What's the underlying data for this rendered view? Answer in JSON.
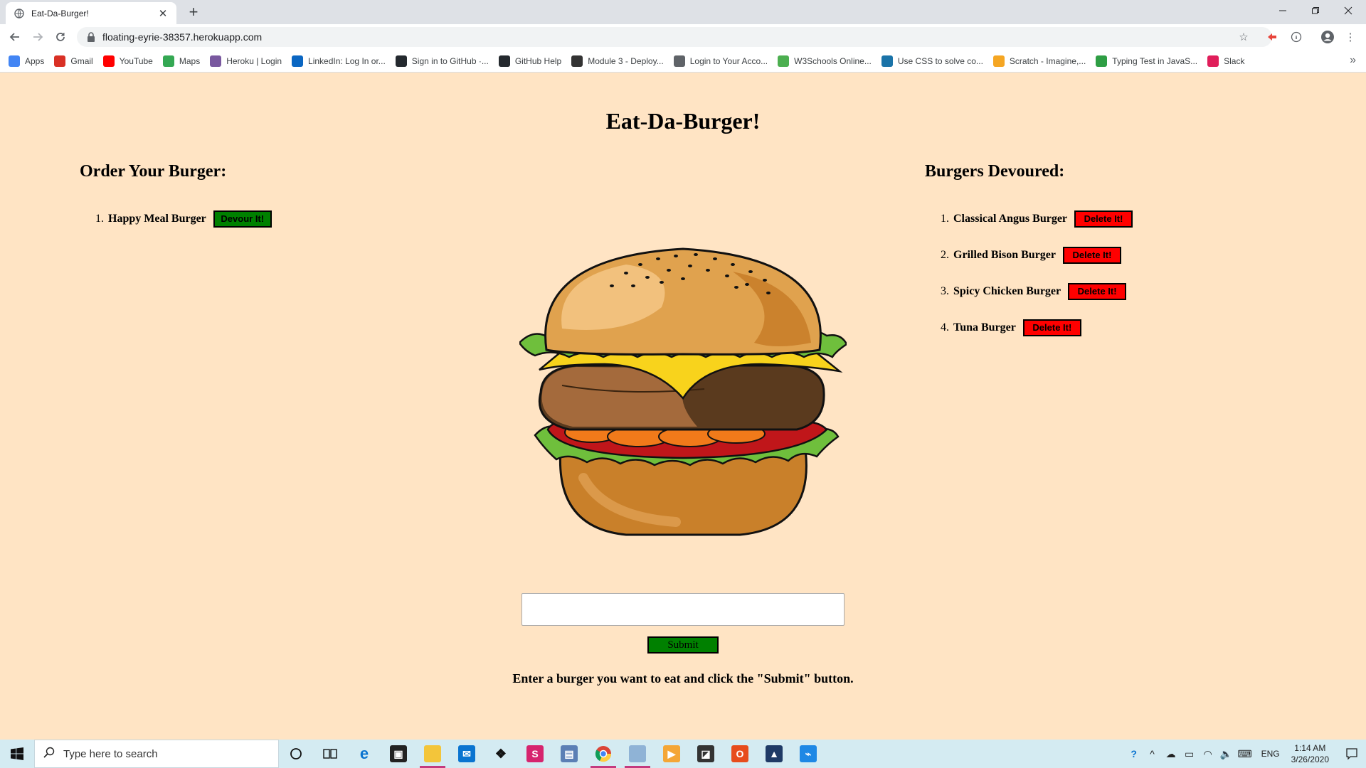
{
  "browser": {
    "tab_title": "Eat-Da-Burger!",
    "new_tab": "+",
    "close_tab": "✕",
    "url": "floating-eyrie-38357.herokuapp.com",
    "bookmarks": [
      {
        "label": "Apps",
        "icon": "apps-grid-icon",
        "color": "#4285f4"
      },
      {
        "label": "Gmail",
        "icon": "gmail-icon",
        "color": "#d93025"
      },
      {
        "label": "YouTube",
        "icon": "youtube-icon",
        "color": "#ff0000"
      },
      {
        "label": "Maps",
        "icon": "maps-icon",
        "color": "#34a853"
      },
      {
        "label": "Heroku | Login",
        "icon": "heroku-icon",
        "color": "#79589f"
      },
      {
        "label": "LinkedIn: Log In or...",
        "icon": "linkedin-icon",
        "color": "#0a66c2"
      },
      {
        "label": "Sign in to GitHub ·...",
        "icon": "github-icon",
        "color": "#24292e"
      },
      {
        "label": "GitHub Help",
        "icon": "github-icon",
        "color": "#24292e"
      },
      {
        "label": "Module 3 - Deploy...",
        "icon": "book-icon",
        "color": "#333333"
      },
      {
        "label": "Login to Your Acco...",
        "icon": "globe-icon",
        "color": "#5f6368"
      },
      {
        "label": "W3Schools Online...",
        "icon": "w3schools-icon",
        "color": "#4caf50"
      },
      {
        "label": "Use CSS to solve co...",
        "icon": "css-icon",
        "color": "#1a73a8"
      },
      {
        "label": "Scratch - Imagine,...",
        "icon": "scratch-icon",
        "color": "#f5a623"
      },
      {
        "label": "Typing Test in JavaS...",
        "icon": "typing-icon",
        "color": "#2e9e44"
      },
      {
        "label": "Slack",
        "icon": "slack-icon",
        "color": "#e01e5a"
      }
    ],
    "bookmarks_more": "»"
  },
  "page": {
    "title": "Eat-Da-Burger!",
    "order_heading": "Order Your Burger:",
    "devoured_heading": "Burgers Devoured:",
    "devour_label": "Devour It!",
    "delete_label": "Delete It!",
    "to_eat": [
      {
        "num": "1.",
        "name": "Happy Meal Burger"
      }
    ],
    "devoured": [
      {
        "num": "1.",
        "name": "Classical Angus Burger"
      },
      {
        "num": "2.",
        "name": "Grilled Bison Burger"
      },
      {
        "num": "3.",
        "name": "Spicy Chicken Burger"
      },
      {
        "num": "4.",
        "name": "Tuna Burger"
      }
    ],
    "input_value": "",
    "submit_label": "Submit",
    "instructions": "Enter a burger you want to eat and click the \"Submit\" button."
  },
  "taskbar": {
    "search_placeholder": "Type here to search",
    "language": "ENG",
    "time": "1:14 AM",
    "date": "3/26/2020"
  },
  "colors": {
    "page_bg": "#ffe4c4",
    "devour_button": "#008000",
    "delete_button": "#ff0000",
    "submit_button": "#008000"
  }
}
